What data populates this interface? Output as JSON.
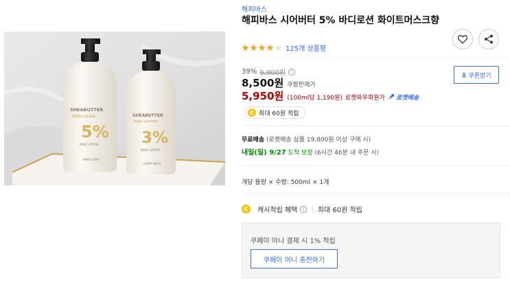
{
  "product": {
    "brand_link": "해피바스",
    "title": "해피바스 시어버터 5% 바디로션 화이트머스크향",
    "rating": {
      "stars": 4.5,
      "max_stars": 5,
      "count_label": "125개 상품평"
    },
    "image": {
      "bottle_left": {
        "brand": "SHEABUTTER",
        "variant": "white musk",
        "number": "5%",
        "line": "BODY LOTION",
        "maker": "HAPPY BATH"
      },
      "bottle_right": {
        "brand": "SHEABUTTER",
        "variant": "baby powder",
        "number": "3%",
        "line": "BODY LOTION",
        "maker": "HAPPY BATH"
      }
    }
  },
  "actions": {
    "wishlist_icon": "heart-icon",
    "share_icon": "share-icon",
    "coupon_button": "쿠폰받기"
  },
  "pricing": {
    "discount_rate": "39%",
    "original_price": "9,900원",
    "sale_price": "8,500원",
    "sale_label": "쿠팡판매가",
    "rocket_price": "5,950원",
    "unit_price": "(100ml당 1,190원)",
    "wow_label": "로켓와우회원가",
    "rocket_badge": "로켓배송",
    "points": "최대 60원 적립",
    "coin_glyph": "C"
  },
  "shipping": {
    "free_label": "무료배송",
    "free_detail": "(로켓배송 상품 19,800원 이상 구매 시)",
    "arrival": "내일(일) 9/27",
    "arrival_suffix": "도착 보장",
    "deadline": "(6시간 46분 내 주문 시)"
  },
  "option": {
    "text": "개당 용량 × 수량: 500ml × 1개"
  },
  "cash": {
    "label": "캐시적립 혜택",
    "max": "최대 60원 적립"
  },
  "coupay": {
    "text": "쿠페이 머니 결제 시 1% 적립",
    "button": "쿠페이 머니 충전하기"
  },
  "colors": {
    "link_blue": "#346aff",
    "rocket_red": "#ae0000",
    "arrival_green": "#008c00",
    "star_orange": "#f5a623",
    "coin_yellow": "#f7c600"
  }
}
